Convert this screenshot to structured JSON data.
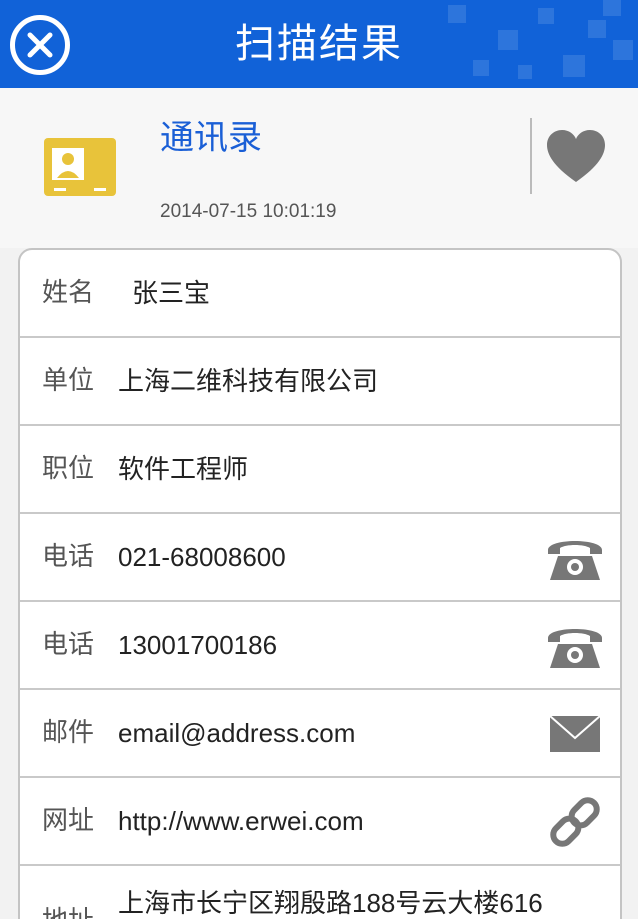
{
  "header": {
    "title": "扫描结果",
    "accent_color": "#1162d8",
    "close_icon": "close-icon"
  },
  "summary": {
    "category": "通讯录",
    "timestamp": "2014-07-15 10:01:19",
    "icon": "contact-card-icon",
    "favorite_icon": "heart-icon"
  },
  "fields": [
    {
      "label": "姓名",
      "value": "张三宝"
    },
    {
      "label": "单位",
      "value": "上海二维科技有限公司"
    },
    {
      "label": "职位",
      "value": "软件工程师"
    },
    {
      "label": "电话",
      "value": "021-68008600",
      "action_icon": "phone-icon"
    },
    {
      "label": "电话",
      "value": "13001700186",
      "action_icon": "phone-icon"
    },
    {
      "label": "邮件",
      "value": "email@address.com",
      "action_icon": "mail-icon"
    },
    {
      "label": "网址",
      "value": "http://www.erwei.com",
      "action_icon": "link-icon"
    },
    {
      "label": "地址",
      "value": "上海市长宁区翔殷路188号云大楼616"
    }
  ]
}
